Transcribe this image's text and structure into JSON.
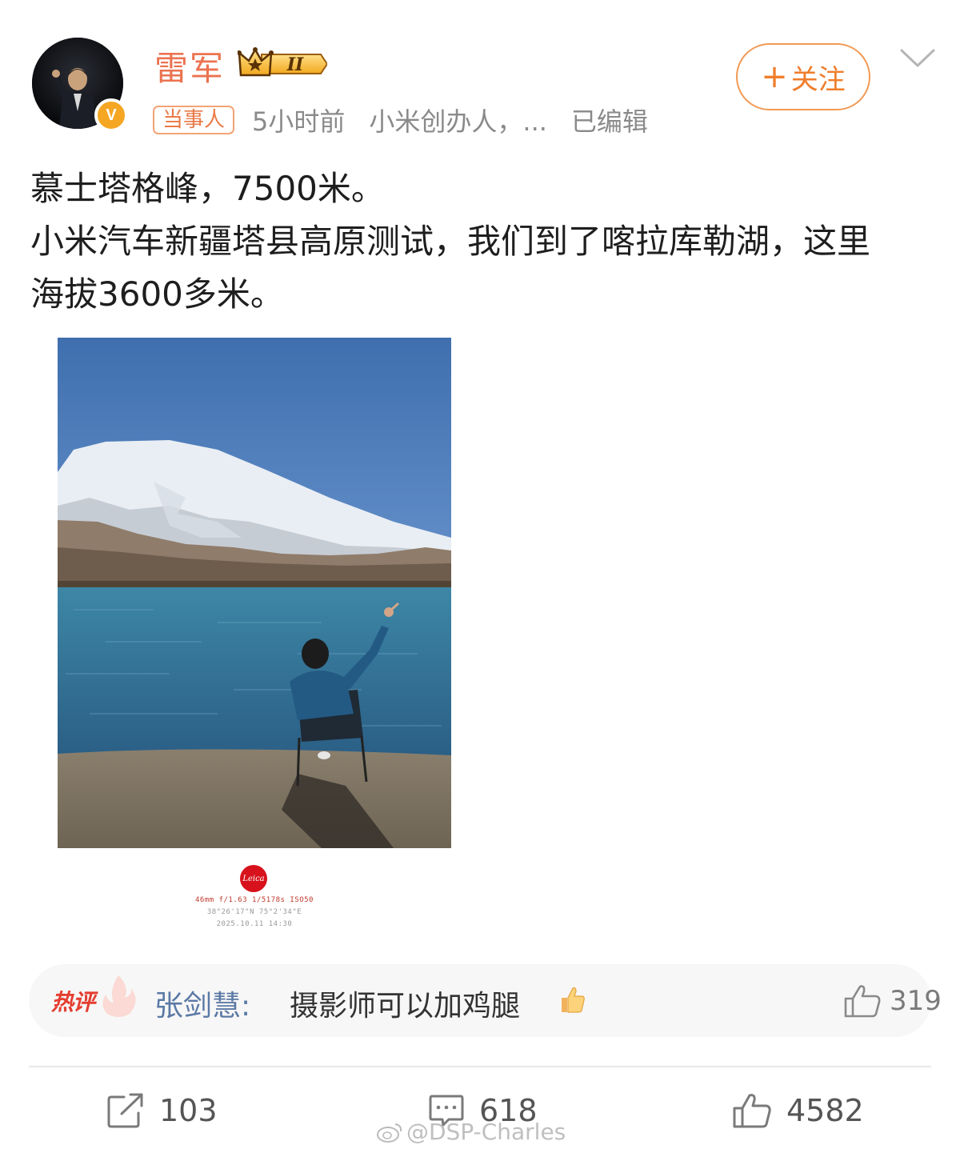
{
  "header": {
    "username": "雷军",
    "vip_level": "II",
    "tag": "当事人",
    "time": "5小时前",
    "bio": "小米创办人，...",
    "edited": "已编辑",
    "follow_label": "关注",
    "verified_mark": "V"
  },
  "post": {
    "lines": [
      "慕士塔格峰，7500米。",
      "小米汽车新疆塔县高原测试，我们到了喀拉库勒湖，这里",
      "海拔3600多米。"
    ]
  },
  "photo": {
    "brand": "Leica",
    "exif_line1": "46mm  f/1.63  1/5178s  ISO50",
    "exif_line2": "38°26'17\"N  75°2'34\"E",
    "exif_line3": "2025.10.11 14:30"
  },
  "hot_comment": {
    "label": "热评",
    "author": "张剑慧:",
    "text": "摄影师可以加鸡腿",
    "likes": "319"
  },
  "actions": {
    "reposts": "103",
    "comments": "618",
    "likes": "4582"
  },
  "watermark": "@DSP-Charles",
  "colors": {
    "username": "#eb7350",
    "follow": "#f07d2b",
    "hot_label": "#e43d2f",
    "comment_author": "#5b79a5"
  }
}
